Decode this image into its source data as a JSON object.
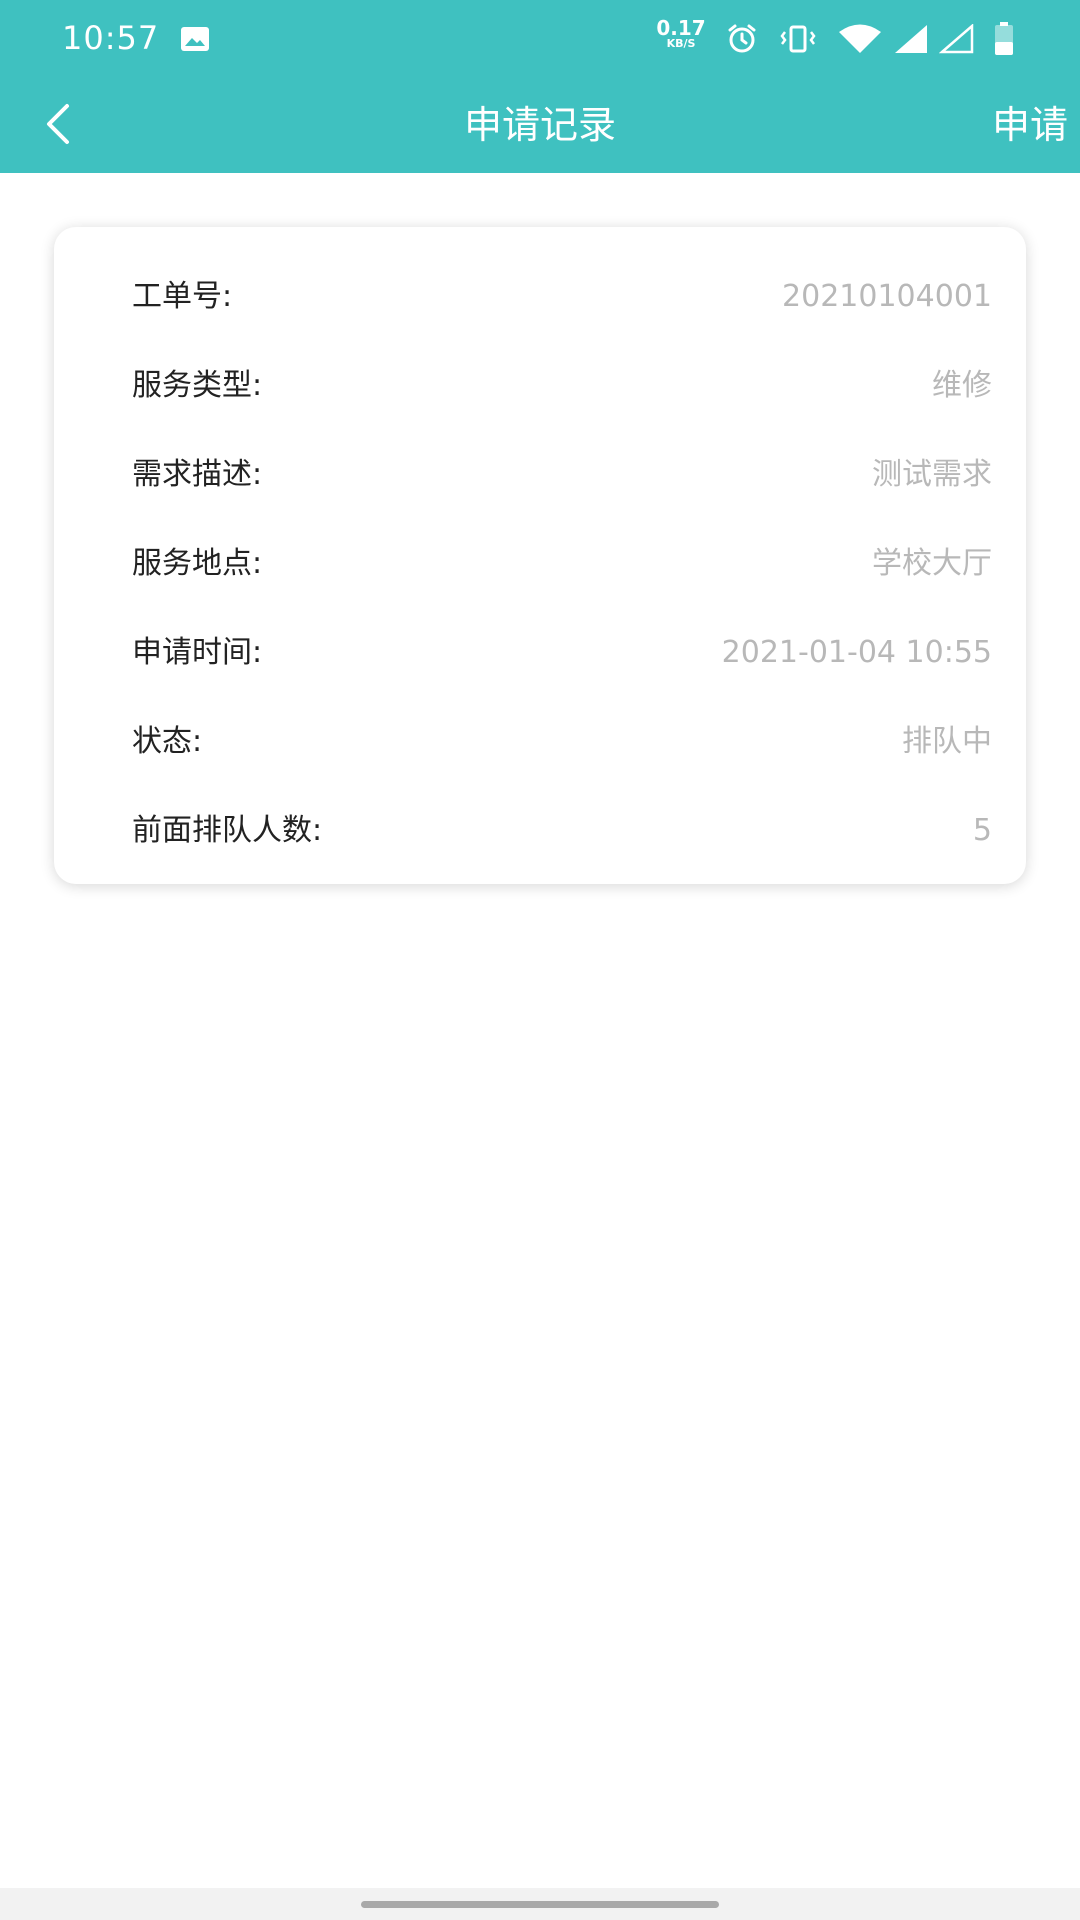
{
  "status_bar": {
    "time": "10:57",
    "net_speed_value": "0.17",
    "net_speed_unit": "KB/S",
    "icons": [
      "image-icon",
      "alarm-icon",
      "vibrate-icon",
      "wifi-icon",
      "signal-icon",
      "signal-empty-icon",
      "battery-icon"
    ]
  },
  "nav": {
    "back_icon": "chevron-left-icon",
    "title": "申请记录",
    "action_label": "申请"
  },
  "record": {
    "rows": [
      {
        "label": "工单号:",
        "value": "20210104001"
      },
      {
        "label": "服务类型:",
        "value": "维修"
      },
      {
        "label": "需求描述:",
        "value": "测试需求"
      },
      {
        "label": "服务地点:",
        "value": "学校大厅"
      },
      {
        "label": "申请时间:",
        "value": "2021-01-04 10:55"
      },
      {
        "label": "状态:",
        "value": "排队中"
      },
      {
        "label": "前面排队人数:",
        "value": "5"
      }
    ]
  },
  "colors": {
    "primary": "#3fc1c0",
    "label_text": "#222222",
    "value_text": "#b8b8b8"
  }
}
